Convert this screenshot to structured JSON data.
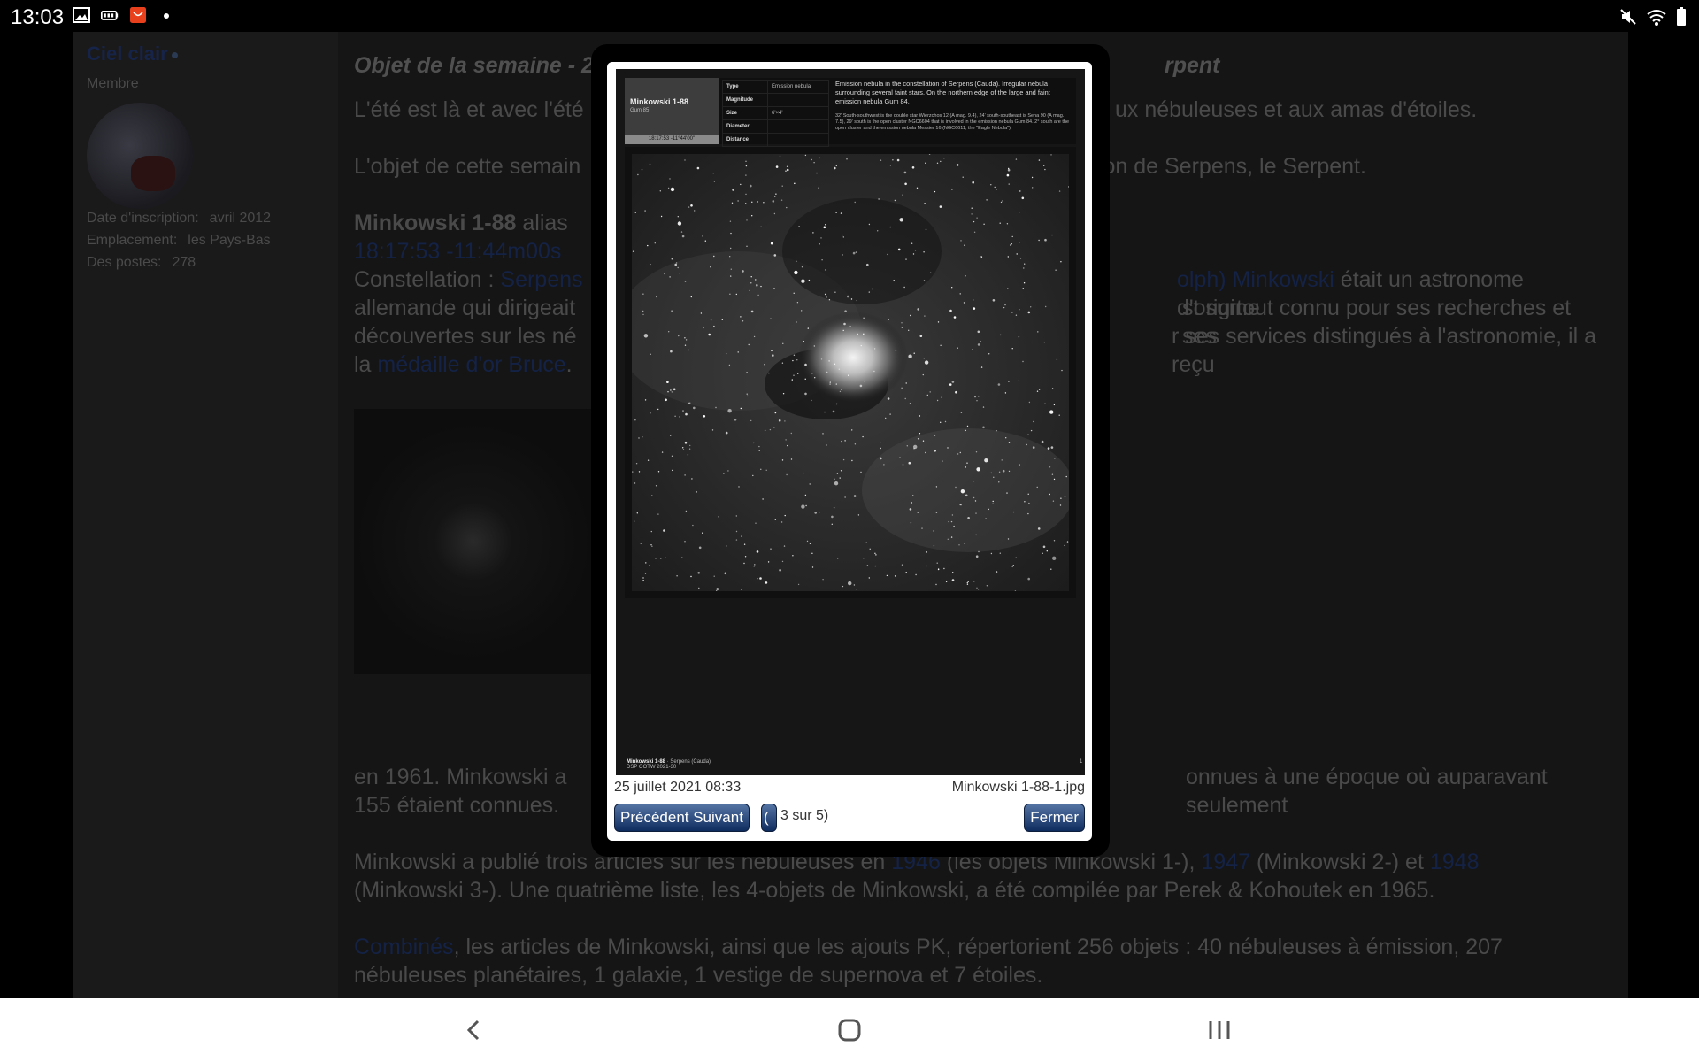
{
  "status_bar": {
    "time": "13:03",
    "left_icons": [
      "gallery-icon",
      "battery-saver-icon",
      "shopping-app-icon",
      "notification-dot-icon"
    ],
    "right_icons": [
      "mute-icon",
      "wifi-icon",
      "battery-icon"
    ]
  },
  "sidebar": {
    "username": "Ciel clair",
    "role": "Membre",
    "details": [
      {
        "label": "Date d'inscription:",
        "value": "avril 2012"
      },
      {
        "label": "Emplacement:",
        "value": "les Pays-Bas"
      },
      {
        "label": "Des postes:",
        "value": "278"
      }
    ]
  },
  "post": {
    "title_visible": "Objet de la semaine - 2",
    "title_end": "rpent",
    "para1_start": "L'été est là et avec l'été",
    "para1_end": "ux nébuleuses et aux amas d'étoiles.",
    "para2_start": "L'objet de cette semain",
    "para2_end": "tion de Serpens, le Serpent.",
    "object_name": "Minkowski 1-88",
    "alias_text": "alias",
    "coords_link": "18:17:53 -11:44m00s",
    "constellation_label": "Constellation :",
    "constellation_link": "Serpens",
    "astronomer_link": "olph) Minkowski",
    "astronomer_text": " était un astronome d'origine",
    "line_b_start": "allemande qui dirigeait",
    "line_b_end": "st surtout connu pour ses recherches et ses",
    "line_c_start": "découvertes sur les né",
    "line_c_end": "r ses services distingués à l'astronomie, il a reçu",
    "line_d_start": "la",
    "medal_link": "médaille d'or Bruce",
    "line_d_end": ".",
    "line_e_start": "en 1961. Minkowski a",
    "line_e_end": "onnues à une époque où auparavant seulement",
    "line_f": "155 étaient connues.",
    "para_pub": "Minkowski a publié trois articles sur les nébuleuses en",
    "year1": "1946",
    "pub_mid1": "(les objets Minkowski 1-),",
    "year2": "1947",
    "pub_mid2": "(Minkowski 2-) et",
    "year3": "1948",
    "pub_line2": "(Minkowski 3-). Une quatrième liste, les 4-objets de Minkowski, a été compilée par Perek & Kohoutek en 1965.",
    "combined_link": "Combinés",
    "combined_text": ", les articles de Minkowski, ainsi que les ajouts PK, répertorient 256 objets : 40 nébuleuses à émission, 207",
    "combined_line2": "nébuleuses planétaires, 1 galaxie, 1 vestige de supernova et 7 étoiles."
  },
  "lightbox": {
    "card": {
      "name": "Minkowski 1-88",
      "alias": "Gum 85",
      "coord": "18:17:53 -11°44'00\"",
      "rows": [
        {
          "k": "Type",
          "v": "Emission nebula"
        },
        {
          "k": "Magnitude",
          "v": ""
        },
        {
          "k": "Size",
          "v": "6'×4'"
        },
        {
          "k": "Diameter",
          "v": ""
        },
        {
          "k": "Distance",
          "v": ""
        }
      ],
      "desc": "Emission nebula in the constellation of Serpens (Cauda). Irregular nebula surrounding several faint stars. On the northern edge of the large and faint emission nebula Gum 84.",
      "desc_small": "32' South-southwest is the double star Wierzchos 12 (A mag. 9.4), 24' south-southeast is Sena 90 (A mag. 7.5), 29' south is the open cluster NGC6604 that is involved in the emission nebula Gum 84. 2° south are the open cluster and the emission nebula Messier 16 (NGC6611, the \"Eagle Nebula\").",
      "footer_name": "Minkowski 1-88",
      "footer_const": "· Serpens (Cauda)",
      "footer_sub": "DSP OOTW 2021-30",
      "page_num": "1"
    },
    "date": "25 juillet 2021 08:33",
    "filename": "Minkowski 1-88-1.jpg",
    "prev_next_label": "Précédent Suivant",
    "slideshow_label": "(",
    "count": "3 sur 5)",
    "close_label": "Fermer"
  },
  "navbar": {
    "back": "back-icon",
    "home": "home-icon",
    "recents": "recents-icon"
  }
}
